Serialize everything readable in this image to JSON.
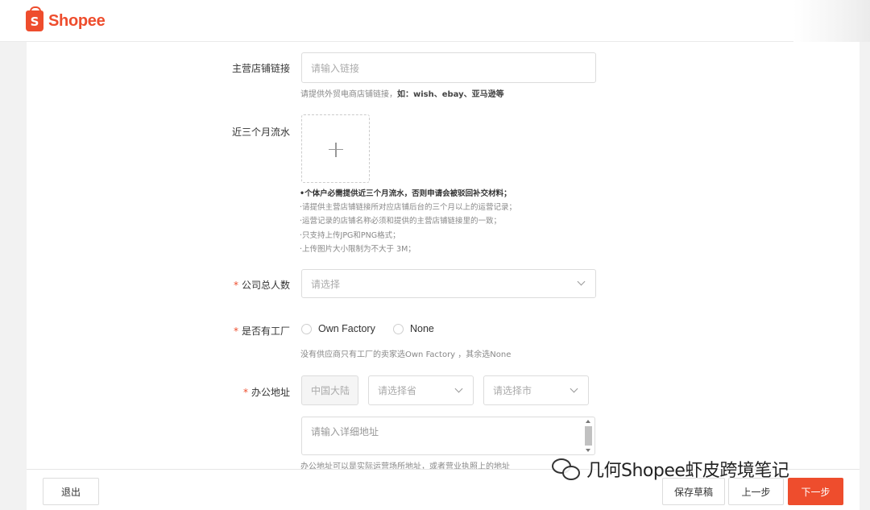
{
  "header": {
    "logo_letter": "S",
    "logo_text": "Shopee"
  },
  "form": {
    "shop_link": {
      "label": "主营店铺链接",
      "placeholder": "请输入链接",
      "hint_prefix": "请提供外贸电商店铺链接，",
      "hint_bold": "如：wish、ebay、亚马逊等"
    },
    "turnover": {
      "label": "近三个月流水",
      "upload_icon": "plus-icon",
      "notes": [
        "•个体户必需提供近三个月流水，否则申请会被驳回补交材料；",
        "·请提供主营店铺链接所对应店铺后台的三个月以上的运营记录；",
        "·运营记录的店铺名称必须和提供的主营店铺链接里的一致；",
        "·只支持上传JPG和PNG格式；",
        "·上传图片大小限制为不大于 3M；"
      ]
    },
    "employees": {
      "required": "*",
      "label": "公司总人数",
      "placeholder": "请选择"
    },
    "factory": {
      "required": "*",
      "label": "是否有工厂",
      "options": [
        "Own Factory",
        "None"
      ],
      "hint": "没有供应商只有工厂的卖家选Own Factory ，其余选None"
    },
    "office": {
      "required": "*",
      "label": "办公地址",
      "country": "中国大陆",
      "province_placeholder": "请选择省",
      "city_placeholder": "请选择市",
      "detail_placeholder": "请输入详细地址",
      "hint": "办公地址可以是实际运营场所地址，或者营业执照上的地址"
    }
  },
  "footer": {
    "exit": "退出",
    "save_draft": "保存草稿",
    "prev": "上一步",
    "next": "下一步"
  },
  "watermark": {
    "text": "几何Shopee虾皮跨境笔记",
    "icon": "wechat-icon"
  },
  "colors": {
    "brand": "#ee4d2d",
    "required": "#ee4d2d"
  }
}
